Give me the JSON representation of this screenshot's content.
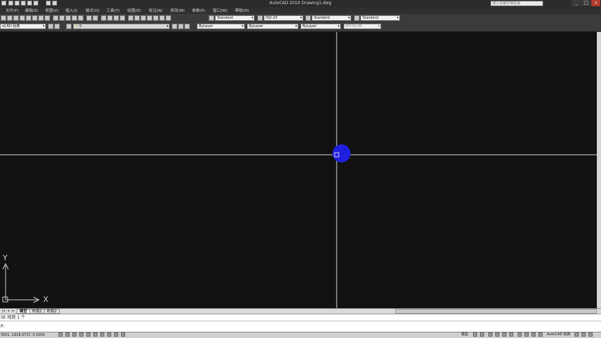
{
  "window": {
    "title": "AutoCAD 2010    Drawing1.dwg",
    "search_placeholder": "键入关键字或短语",
    "controls": {
      "minimize": "_",
      "maximize": "□",
      "close": "×"
    }
  },
  "menu": {
    "items": [
      "文件(F)",
      "编辑(E)",
      "视图(V)",
      "插入(I)",
      "格式(O)",
      "工具(T)",
      "绘图(D)",
      "标注(N)",
      "修改(M)",
      "参数(P)",
      "窗口(W)",
      "帮助(H)"
    ]
  },
  "toolbar1": {
    "text_style": "Standard",
    "dim_style": "ISO-25",
    "table_style": "Standard",
    "mleader_style": "Standard"
  },
  "toolbar2": {
    "workspace": "oCAD 经典",
    "layer": "0",
    "color": "ByLayer",
    "linetype": "ByLayer",
    "lineweight": "ByLayer",
    "plotstyle": "BYCOLOR"
  },
  "canvas": {
    "background": "#111111",
    "crosshair_color": "#d8d8d8",
    "highlight_color": "#1f1fe0",
    "ucs": {
      "y_label": "Y",
      "x_label": "X"
    }
  },
  "tabs": {
    "model": "模型",
    "layout1": "布局1",
    "layout2": "布局2"
  },
  "command": {
    "history": "SE 找到 1 个",
    "prompt": "P:"
  },
  "status": {
    "coordinates": "3501, 1918.0737, 0.0000",
    "model_label": "模型",
    "workspace_label": "AutoCAD 经典"
  }
}
